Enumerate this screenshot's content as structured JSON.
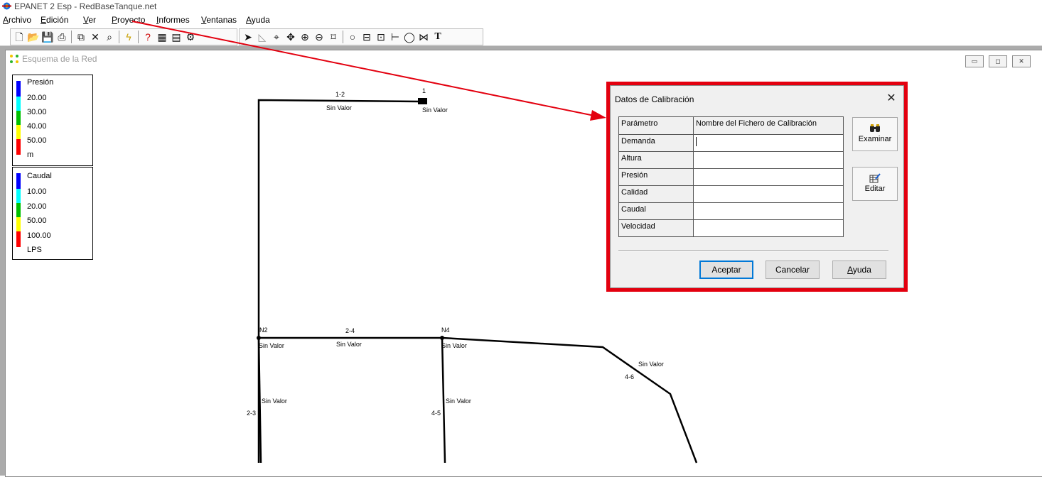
{
  "app": {
    "title": "EPANET 2 Esp - RedBaseTanque.net"
  },
  "menu": [
    "Archivo",
    "Edición",
    "Ver",
    "Proyecto",
    "Informes",
    "Ventanas",
    "Ayuda"
  ],
  "toolbar": {
    "icons": [
      "new-file-icon",
      "open-folder-icon",
      "save-icon",
      "print-icon",
      "copy-icon",
      "delete-icon",
      "find-icon",
      "run-icon",
      "query-icon",
      "graph-icon",
      "table-icon",
      "options-icon",
      "select-arrow-icon",
      "select-vertex-icon",
      "select-region-icon",
      "pan-icon",
      "zoom-in-icon",
      "zoom-out-icon",
      "full-extent-icon",
      "add-junction-icon",
      "add-reservoir-icon",
      "add-tank-icon",
      "add-pipe-icon",
      "add-pump-icon",
      "add-valve-icon",
      "add-label-icon"
    ]
  },
  "map_window": {
    "title": "Esquema de la Red",
    "legend_pressure": {
      "title": "Presión",
      "values": [
        "20.00",
        "30.00",
        "40.00",
        "50.00"
      ],
      "unit": "m",
      "colors": [
        "#0000ff",
        "#00ffff",
        "#00c000",
        "#ffff00",
        "#ff0000"
      ]
    },
    "legend_flow": {
      "title": "Caudal",
      "values": [
        "10.00",
        "20.00",
        "50.00",
        "100.00"
      ],
      "unit": "LPS",
      "colors": [
        "#0000ff",
        "#00ffff",
        "#00c000",
        "#ffff00",
        "#ff0000"
      ]
    },
    "labels": {
      "pipe_1_2": "1-2",
      "pipe_1_2_value": "Sin Valor",
      "node_1": "1",
      "node_1_value": "Sin Valor",
      "node_n2": "N2",
      "node_n2_value": "Sin Valor",
      "pipe_2_4": "2-4",
      "pipe_2_4_value": "Sin Valor",
      "node_n4": "N4",
      "node_n4_value": "Sin Valor",
      "pipe_4_6": "4-6",
      "pipe_4_6_value": "Sin Valor",
      "pipe_2_3": "2-3",
      "pipe_2_3_value": "Sin Valor",
      "pipe_4_5": "4-5",
      "pipe_4_5_value": "Sin Valor"
    }
  },
  "dialog": {
    "title": "Datos de Calibración",
    "close_glyph": "✕",
    "grid_header": [
      "Parámetro",
      "Nombre del Fichero de Calibración"
    ],
    "rows": [
      {
        "param": "Demanda",
        "file": ""
      },
      {
        "param": "Altura",
        "file": ""
      },
      {
        "param": "Presión",
        "file": ""
      },
      {
        "param": "Calidad",
        "file": ""
      },
      {
        "param": "Caudal",
        "file": ""
      },
      {
        "param": "Velocidad",
        "file": ""
      }
    ],
    "browse_label": "Examinar",
    "edit_label": "Editar",
    "ok_label": "Aceptar",
    "cancel_label": "Cancelar",
    "help_label": "Ayuda"
  },
  "colors": {
    "highlight_border": "#e3000f",
    "annotation_arrow": "#e3000f"
  }
}
